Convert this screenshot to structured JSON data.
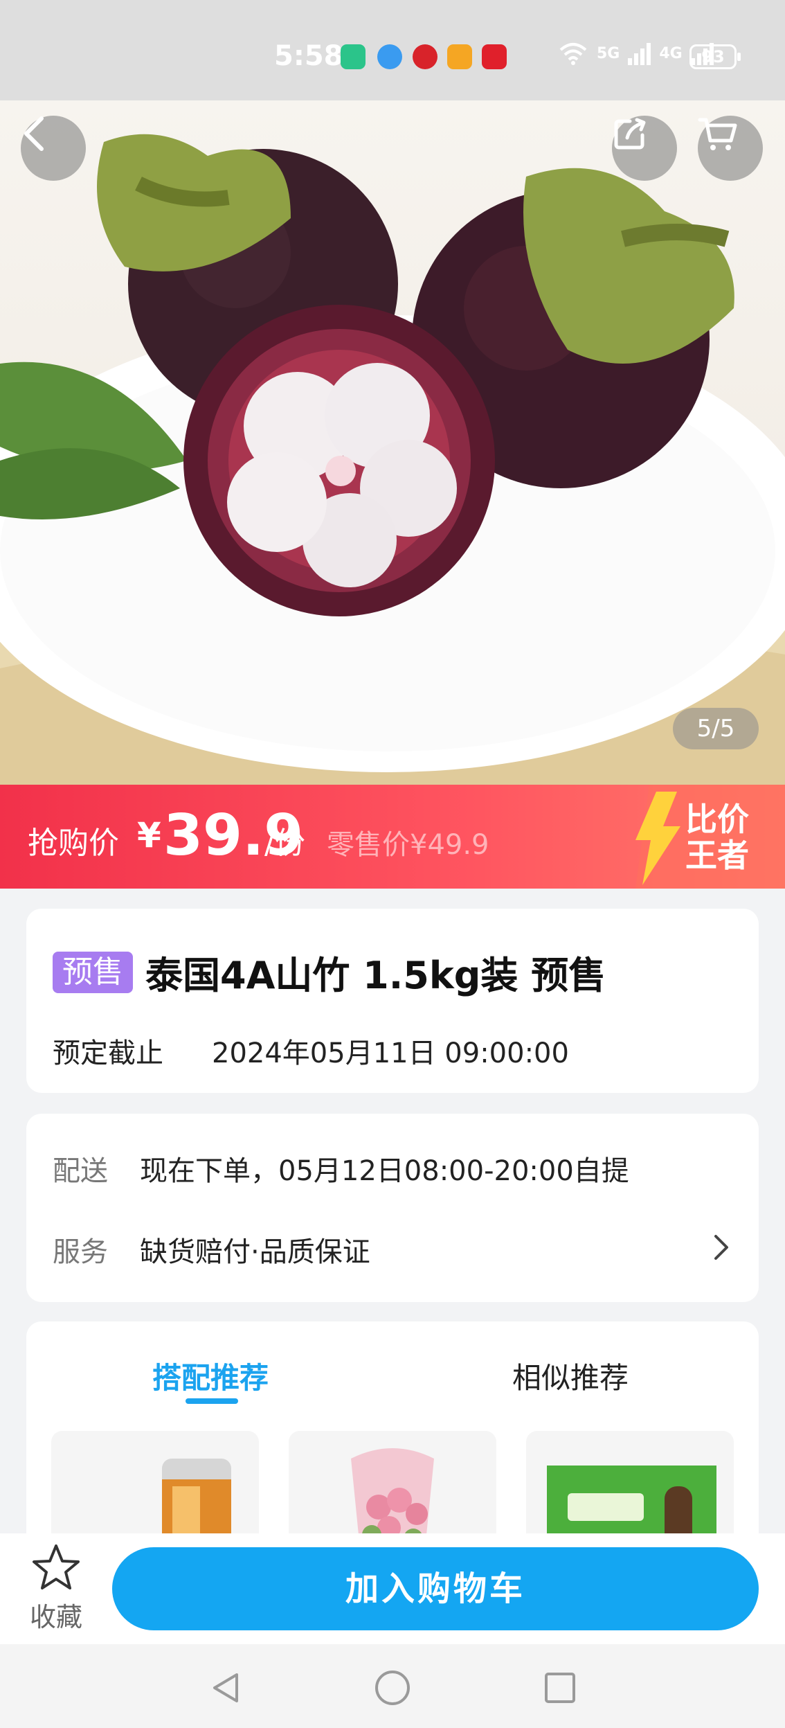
{
  "status_bar": {
    "time": "5:58",
    "network_1": "5G",
    "network_2": "4G",
    "battery": "93"
  },
  "hero": {
    "image_counter": "5/5"
  },
  "price_banner": {
    "label": "抢购价",
    "currency": "¥",
    "price": "39.9",
    "unit": "/份",
    "retail_price": "零售价¥49.9",
    "badge_text": "比价王者"
  },
  "product": {
    "tag": "预售",
    "title": "泰国4A山竹 1.5kg装 预售",
    "deadline_label": "预定截止",
    "deadline_value": "2024年05月11日 09:00:00"
  },
  "service": {
    "delivery_label": "配送",
    "delivery_value": "现在下单，05月12日08:00-20:00自提",
    "service_label": "服务",
    "service_value": "缺货赔付·品质保证"
  },
  "recommend": {
    "tabs": [
      "搭配推荐",
      "相似推荐"
    ],
    "active_tab": 0
  },
  "bottom_bar": {
    "favorite_label": "收藏",
    "add_to_cart": "加入购物车"
  },
  "colors": {
    "accent": "#14a6f2",
    "price_red": "#f2314a",
    "presale_purple": "#a77cf0"
  }
}
